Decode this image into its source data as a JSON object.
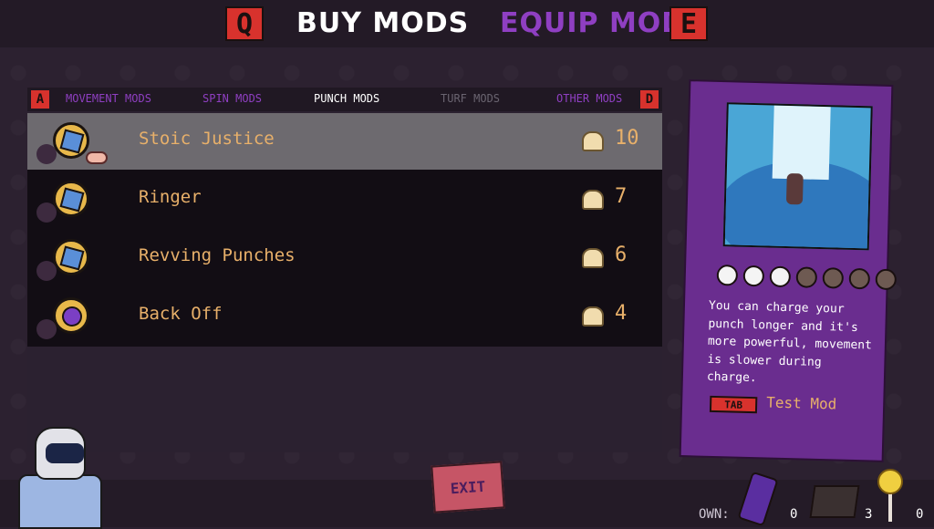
{
  "top": {
    "left_key": "Q",
    "buy_title": "BUY MODS",
    "equip_title": "EQUIP MODS",
    "right_key": "E"
  },
  "tabs": {
    "left_key": "A",
    "right_key": "D",
    "items": [
      "MOVEMENT MODS",
      "SPIN MODS",
      "PUNCH MODS",
      "TURF MODS",
      "OTHER MODS"
    ]
  },
  "mods": [
    {
      "name": "Stoic Justice",
      "price": "10",
      "icon": "stoic-justice-icon"
    },
    {
      "name": "Ringer",
      "price": "7",
      "icon": "ringer-icon"
    },
    {
      "name": "Revving Punches",
      "price": "6",
      "icon": "revving-punches-icon"
    },
    {
      "name": "Back Off",
      "price": "4",
      "icon": "back-off-icon"
    }
  ],
  "detail": {
    "charge_filled": 3,
    "charge_total": 7,
    "description": "You can charge your punch longer and it's more powerful, movement is slower during charge.",
    "test_key": "TAB",
    "test_label": "Test Mod"
  },
  "exit_label": "EXIT",
  "inventory": {
    "own_label": "OWN:",
    "battery_count": "0",
    "cake_count": "3",
    "lollipop_count": "0"
  },
  "colors": {
    "accent_red": "#d8322d",
    "equip_purple": "#8f3fc2",
    "mod_name": "#e8b06a",
    "card_purple": "#6a2d8f"
  }
}
